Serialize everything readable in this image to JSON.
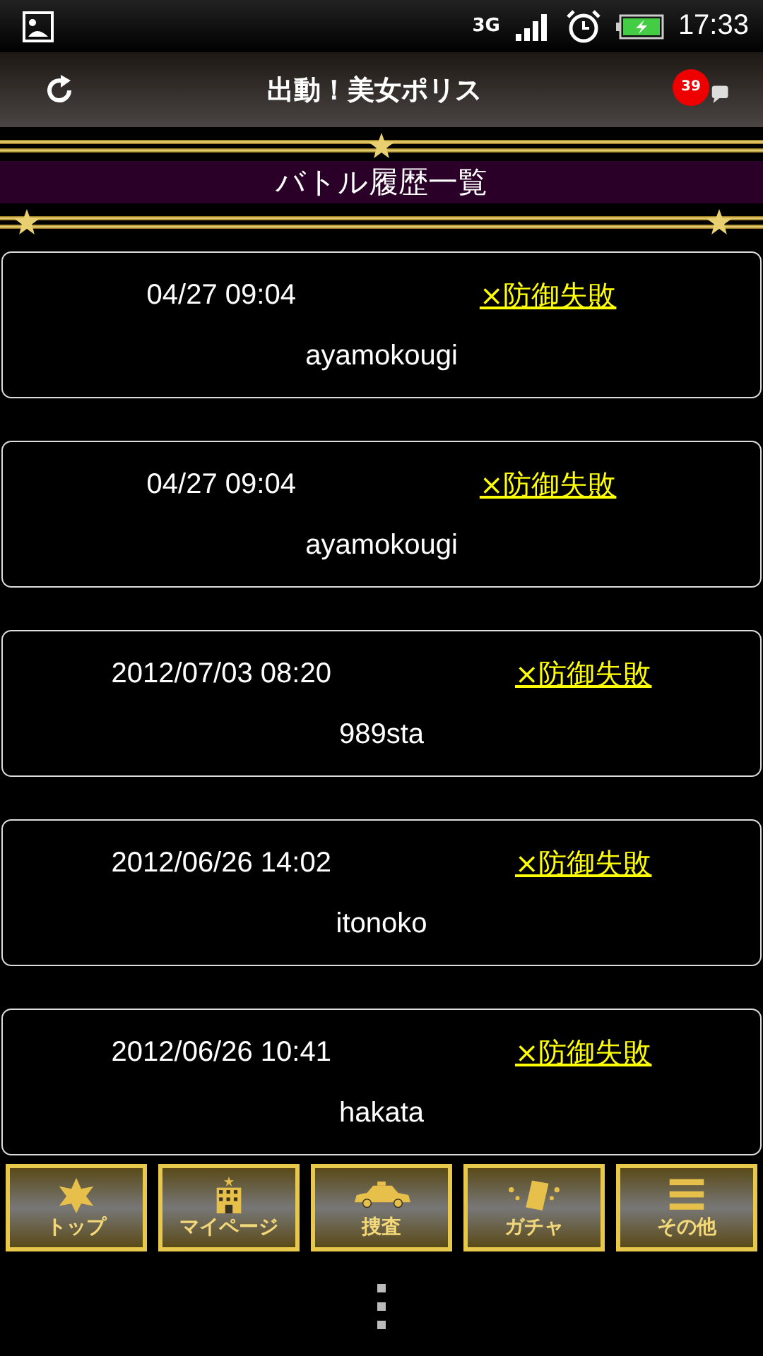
{
  "status_bar": {
    "network": "3G",
    "time": "17:33"
  },
  "header": {
    "title": "出動！美女ポリス",
    "badge": "39"
  },
  "section_title": "バトル履歴一覧",
  "battles": [
    {
      "date": "04/27 09:04",
      "result": "×防御失敗",
      "opponent": "ayamokougi"
    },
    {
      "date": "04/27 09:04",
      "result": "×防御失敗",
      "opponent": "ayamokougi"
    },
    {
      "date": "2012/07/03 08:20",
      "result": "×防御失敗",
      "opponent": "989sta"
    },
    {
      "date": "2012/06/26 14:02",
      "result": "×防御失敗",
      "opponent": "itonoko"
    },
    {
      "date": "2012/06/26 10:41",
      "result": "×防御失敗",
      "opponent": "hakata"
    }
  ],
  "nav": [
    {
      "kind": "badge",
      "label": "トップ"
    },
    {
      "kind": "building",
      "label": "マイページ"
    },
    {
      "kind": "car",
      "label": "捜査"
    },
    {
      "kind": "card",
      "label": "ガチャ"
    },
    {
      "kind": "menu",
      "label": "その他"
    }
  ]
}
